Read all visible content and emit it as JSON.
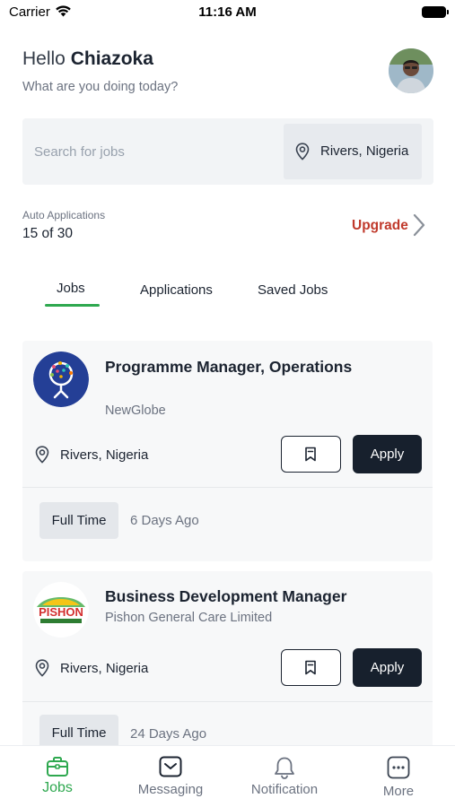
{
  "status_bar": {
    "carrier": "Carrier",
    "time": "11:16 AM"
  },
  "header": {
    "greeting_prefix": "Hello",
    "user_name": "Chiazoka",
    "subtitle": "What are you doing today?"
  },
  "search": {
    "placeholder": "Search for jobs",
    "location": "Rivers, Nigeria"
  },
  "auto_applications": {
    "label": "Auto Applications",
    "count": "15 of 30",
    "upgrade_label": "Upgrade"
  },
  "tabs": [
    {
      "label": "Jobs",
      "active": true
    },
    {
      "label": "Applications",
      "active": false
    },
    {
      "label": "Saved Jobs",
      "active": false
    }
  ],
  "jobs": [
    {
      "title": "Programme Manager, Operations",
      "company": "NewGlobe",
      "location": "Rivers, Nigeria",
      "apply_label": "Apply",
      "type": "Full Time",
      "posted": "6 Days Ago",
      "logo_icon": "newglobe-logo"
    },
    {
      "title": "Business Development Manager",
      "company": "Pishon General Care Limited",
      "location": "Rivers, Nigeria",
      "apply_label": "Apply",
      "type": "Full Time",
      "posted": "24 Days Ago",
      "logo_icon": "pishon-logo",
      "logo_text": "PISHON"
    }
  ],
  "bottom_nav": [
    {
      "label": "Jobs",
      "icon": "briefcase-icon",
      "active": true
    },
    {
      "label": "Messaging",
      "icon": "inbox-icon",
      "active": false
    },
    {
      "label": "Notification",
      "icon": "bell-icon",
      "active": false
    },
    {
      "label": "More",
      "icon": "more-icon",
      "active": false
    }
  ],
  "colors": {
    "accent_green": "#2ea84f",
    "upgrade_red": "#c0392b",
    "primary_dark": "#17202d",
    "card_bg": "#f7f8f9"
  }
}
